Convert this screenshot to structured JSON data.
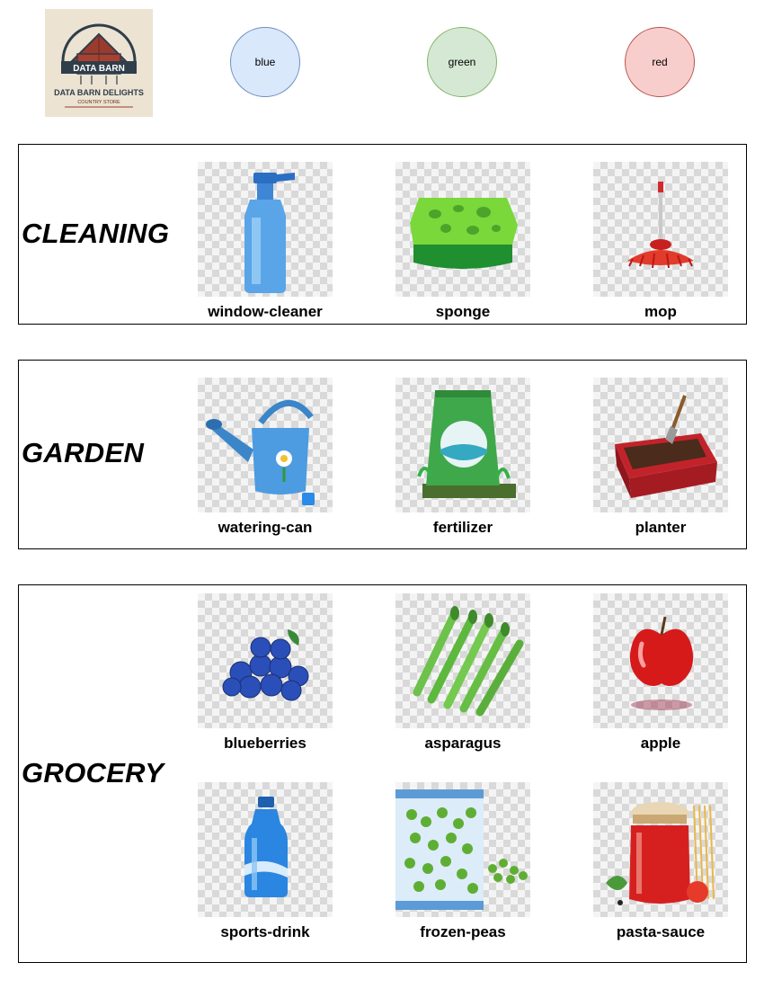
{
  "logo": {
    "title": "DATA BARN",
    "subtitle": "DATA BARN DELIGHTS",
    "tagline": "COUNTRY STORE"
  },
  "legend": [
    {
      "label": "blue",
      "fill": "#dae8fc",
      "stroke": "#6c8ebf"
    },
    {
      "label": "green",
      "fill": "#d5e8d4",
      "stroke": "#82b366"
    },
    {
      "label": "red",
      "fill": "#f8cecc",
      "stroke": "#b85450"
    }
  ],
  "sections": [
    {
      "title": "CLEANING",
      "items": [
        {
          "label": "window-cleaner",
          "icon": "spray-bottle-icon"
        },
        {
          "label": "sponge",
          "icon": "sponge-icon"
        },
        {
          "label": "mop",
          "icon": "mop-icon"
        }
      ]
    },
    {
      "title": "GARDEN",
      "items": [
        {
          "label": "watering-can",
          "icon": "watering-can-icon"
        },
        {
          "label": "fertilizer",
          "icon": "fertilizer-bag-icon"
        },
        {
          "label": "planter",
          "icon": "planter-box-icon"
        }
      ]
    },
    {
      "title": "GROCERY",
      "items": [
        {
          "label": "blueberries",
          "icon": "blueberries-icon"
        },
        {
          "label": "asparagus",
          "icon": "asparagus-icon"
        },
        {
          "label": "apple",
          "icon": "apple-icon"
        },
        {
          "label": "sports-drink",
          "icon": "sports-drink-bottle-icon"
        },
        {
          "label": "frozen-peas",
          "icon": "frozen-peas-bag-icon"
        },
        {
          "label": "pasta-sauce",
          "icon": "pasta-sauce-jar-icon"
        }
      ]
    }
  ]
}
